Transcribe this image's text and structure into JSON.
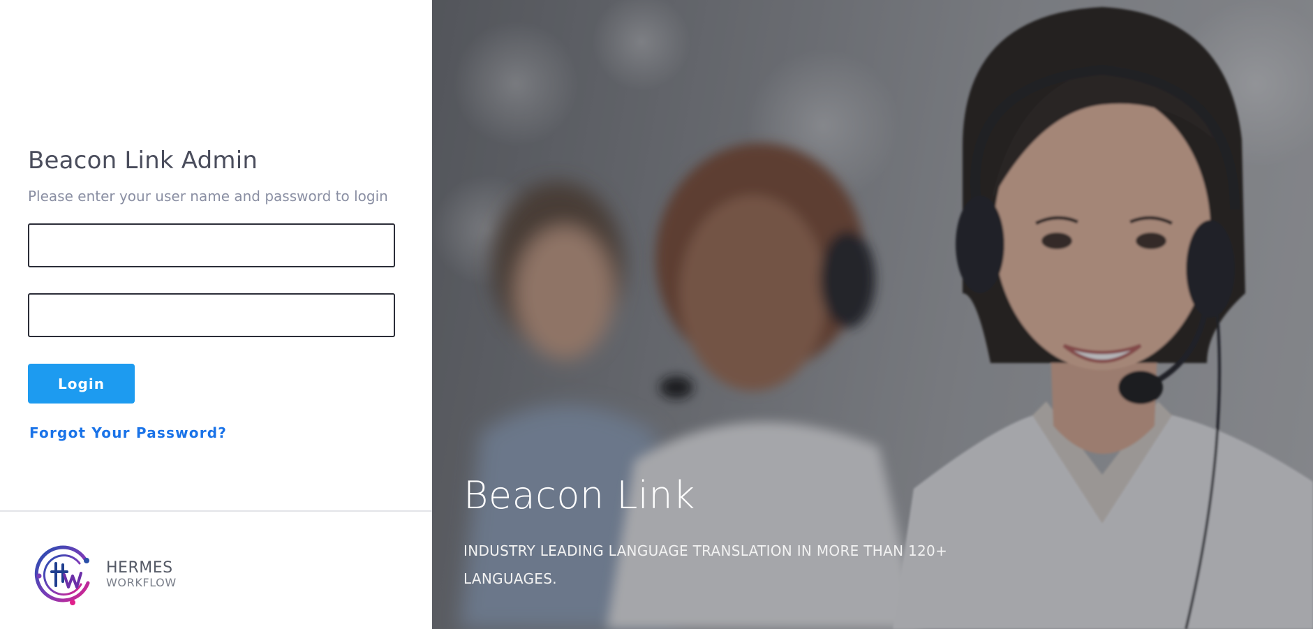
{
  "login": {
    "title": "Beacon Link Admin",
    "subtitle": "Please enter your user name and password to login",
    "username_value": "",
    "password_value": "",
    "login_label": "Login",
    "forgot_label": "Forgot Your Password?"
  },
  "logo": {
    "line1": "HERMES",
    "line2": "WORKFLOW",
    "icon": "hermes-workflow-logo-icon"
  },
  "hero": {
    "title": "Beacon Link",
    "subtitle": "INDUSTRY LEADING LANGUAGE TRANSLATION IN MORE THAN 120+ LANGUAGES.",
    "image": "call-center-agents-with-headsets-photo"
  },
  "colors": {
    "accent": "#1d9bf0",
    "link": "#1a73e8",
    "title_text": "#4a4d5c",
    "subtitle_text": "#8a8fa3"
  }
}
